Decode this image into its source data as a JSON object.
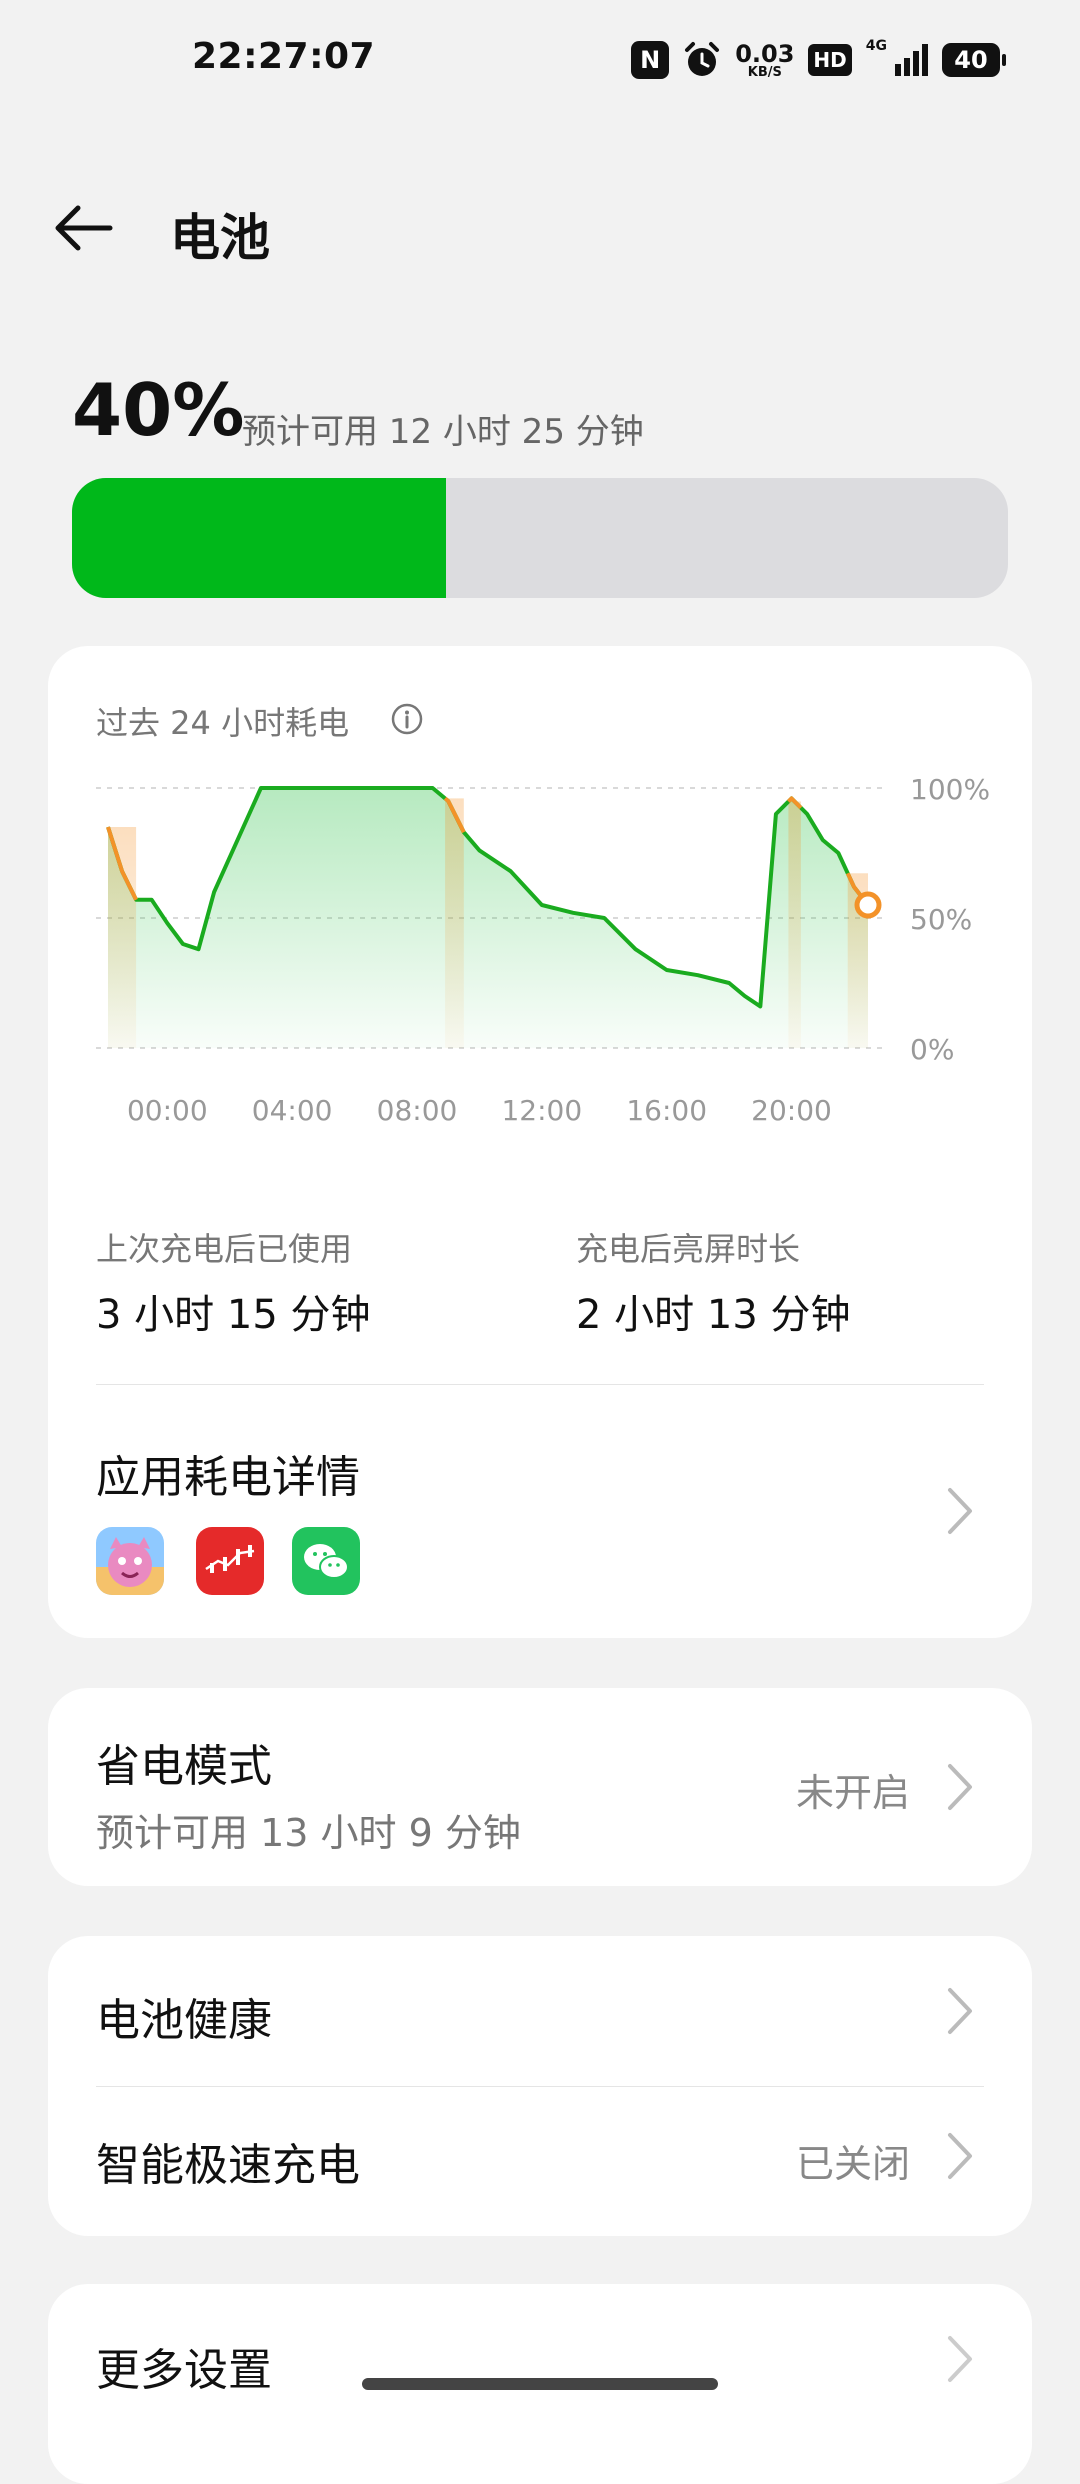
{
  "status_bar": {
    "time": "22:27:07",
    "nfc_icon": "nfc-icon",
    "alarm_icon": "alarm-icon",
    "net_speed": "0.03",
    "net_unit": "KB/S",
    "hd": "HD",
    "network": "4G",
    "battery": "40"
  },
  "header": {
    "back_icon": "arrow-left-icon",
    "title": "电池"
  },
  "battery": {
    "percent": "40%",
    "level": 0.4,
    "estimate": "预计可用 12 小时 25 分钟",
    "fill_color": "#00b81a"
  },
  "usage_card": {
    "title": "过去 24 小时耗电",
    "info_icon": "info-icon",
    "chart_data": {
      "type": "area",
      "y_ticks": [
        "100%",
        "50%",
        "0%"
      ],
      "ylim": [
        0,
        100
      ],
      "x_ticks": [
        "00:00",
        "04:00",
        "08:00",
        "12:00",
        "16:00",
        "20:00"
      ],
      "x_range_hours": [
        -1.9,
        22.45
      ],
      "x": [
        -1.9,
        -1.45,
        -1.0,
        -0.5,
        0.0,
        0.5,
        1.0,
        1.5,
        3.0,
        8.5,
        9.0,
        9.5,
        10.0,
        11.0,
        12.0,
        13.0,
        14.0,
        15.0,
        16.0,
        17.0,
        18.0,
        18.5,
        19.0,
        19.5,
        20.0,
        20.5,
        21.0,
        21.5,
        22.0,
        22.45
      ],
      "values": [
        85,
        68,
        57,
        57,
        48,
        40,
        38,
        60,
        100,
        100,
        95,
        83,
        76,
        68,
        55,
        52,
        50,
        38,
        30,
        28,
        25,
        20,
        16,
        90,
        96,
        90,
        80,
        75,
        62,
        55
      ],
      "line_color": "#1aab1f",
      "charging_color": "#f39229",
      "charging_segments": [
        [
          -1.9,
          -1.0
        ],
        [
          8.9,
          9.5
        ],
        [
          19.9,
          20.3
        ],
        [
          21.8,
          22.45
        ]
      ]
    },
    "stat_left_label": "上次充电后已使用",
    "stat_left_value": "3 小时 15 分钟",
    "stat_right_label": "充电后亮屏时长",
    "stat_right_value": "2 小时 13 分钟",
    "app_usage_title": "应用耗电详情",
    "apps": [
      "game-app-icon",
      "stock-app-icon",
      "wechat-icon"
    ]
  },
  "power_saving": {
    "title": "省电模式",
    "subtitle": "预计可用 13 小时 9 分钟",
    "value": "未开启"
  },
  "health": {
    "title": "电池健康"
  },
  "fast_charge": {
    "title": "智能极速充电",
    "value": "已关闭"
  },
  "more": {
    "title": "更多设置"
  }
}
